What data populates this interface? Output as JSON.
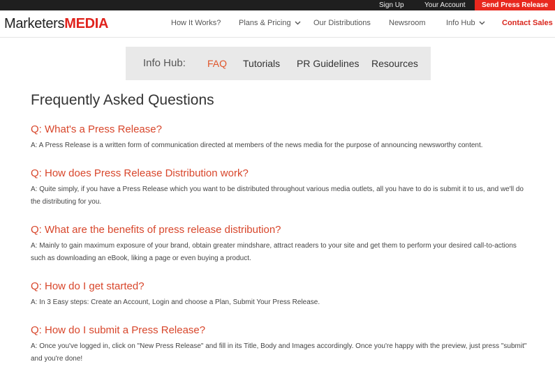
{
  "topbar": {
    "signup": "Sign Up",
    "account": "Your Account",
    "send": "Send Press Release"
  },
  "logo": {
    "part1": "Marketers",
    "part2": "MEDIA"
  },
  "nav": {
    "how": "How It Works?",
    "plans": "Plans & Pricing",
    "distributions": "Our Distributions",
    "newsroom": "Newsroom",
    "infohub": "Info Hub",
    "contact": "Contact Sales"
  },
  "subnav": {
    "label": "Info Hub:",
    "faq": "FAQ",
    "tutorials": "Tutorials",
    "guidelines": "PR Guidelines",
    "resources": "Resources"
  },
  "page_title": "Frequently Asked Questions",
  "faqs": [
    {
      "q": "Q: What's a Press Release?",
      "a": "A: A Press Release is a written form of communication directed at members of the news media for the purpose of announcing newsworthy content."
    },
    {
      "q": "Q: How does Press Release Distribution work?",
      "a": "A: Quite simply, if you have a Press Release which you want to be distributed throughout various media outlets, all you have to do is submit it to us, and we'll do the distributing for you."
    },
    {
      "q": "Q: What are the benefits of press release distribution?",
      "a": "A: Mainly to gain maximum exposure of your brand, obtain greater mindshare, attract readers to your site and get them to perform your desired call-to-actions such as downloading an eBook, liking a page or even buying a product."
    },
    {
      "q": "Q: How do I get started?",
      "a": "A: In 3 Easy steps: Create an Account, Login and choose a Plan, Submit Your Press Release."
    },
    {
      "q": "Q: How do I submit a Press Release?",
      "a": "A: Once you've logged in, click on \"New Press Release\" and fill in its Title, Body and Images accordingly. Once you're happy with the preview, just press \"submit\" and you're done!"
    }
  ],
  "colors": {
    "accent": "#e8281e",
    "question": "#d8462b",
    "topbar": "#1f1f1f"
  }
}
